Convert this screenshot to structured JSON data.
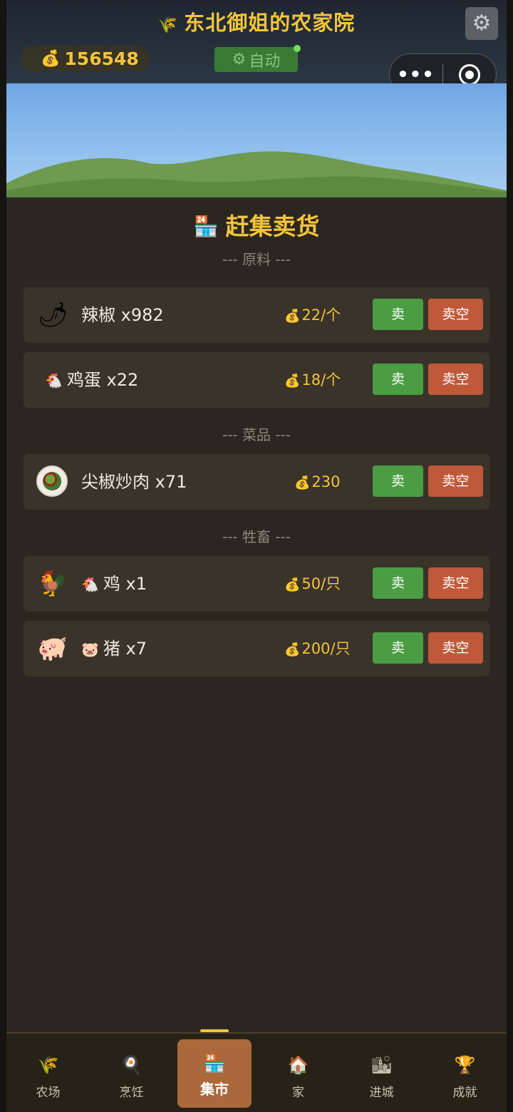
{
  "header": {
    "title_icon": "🌾",
    "title": "东北御姐的农家院",
    "coins_icon": "💰",
    "coins": "156548",
    "auto_icon": "⚙",
    "auto_label": "自动",
    "settings_icon": "⚙",
    "capsule_more": "•••"
  },
  "market": {
    "title_icon": "🏪",
    "title": "赶集卖货",
    "sections": [
      {
        "heading": "--- 原料 ---",
        "items": [
          {
            "big_icon": "🌶",
            "name": "辣椒 x982",
            "price": "22/个"
          },
          {
            "small_icon": "🐔",
            "name": "鸡蛋 x22",
            "price": "18/个"
          }
        ]
      },
      {
        "heading": "--- 菜品 ---",
        "items": [
          {
            "name": "尖椒炒肉 x71",
            "price": "230"
          }
        ]
      },
      {
        "heading": "--- 牲畜 ---",
        "items": [
          {
            "big_icon": "🐓",
            "small_icon": "🐔",
            "name": "鸡 x1",
            "price": "50/只"
          },
          {
            "big_icon": "🐖",
            "small_icon": "🐷",
            "name": "猪 x7",
            "price": "200/只"
          }
        ]
      }
    ],
    "sell_label": "卖",
    "clear_label": "卖空",
    "price_icon": "💰"
  },
  "nav": [
    {
      "icon": "🌾",
      "label": "农场"
    },
    {
      "icon": "🍳",
      "label": "烹饪"
    },
    {
      "icon": "🏪",
      "label": "集市",
      "active": true
    },
    {
      "icon": "🏠",
      "label": "家"
    },
    {
      "icon": "🏙",
      "label": "进城"
    },
    {
      "icon": "🏆",
      "label": "成就"
    }
  ],
  "colors": {
    "accent_gold": "#f3c43c",
    "sell_green": "#4a9d43",
    "clear_orange": "#c0593a",
    "active_tab": "#a9693a"
  }
}
